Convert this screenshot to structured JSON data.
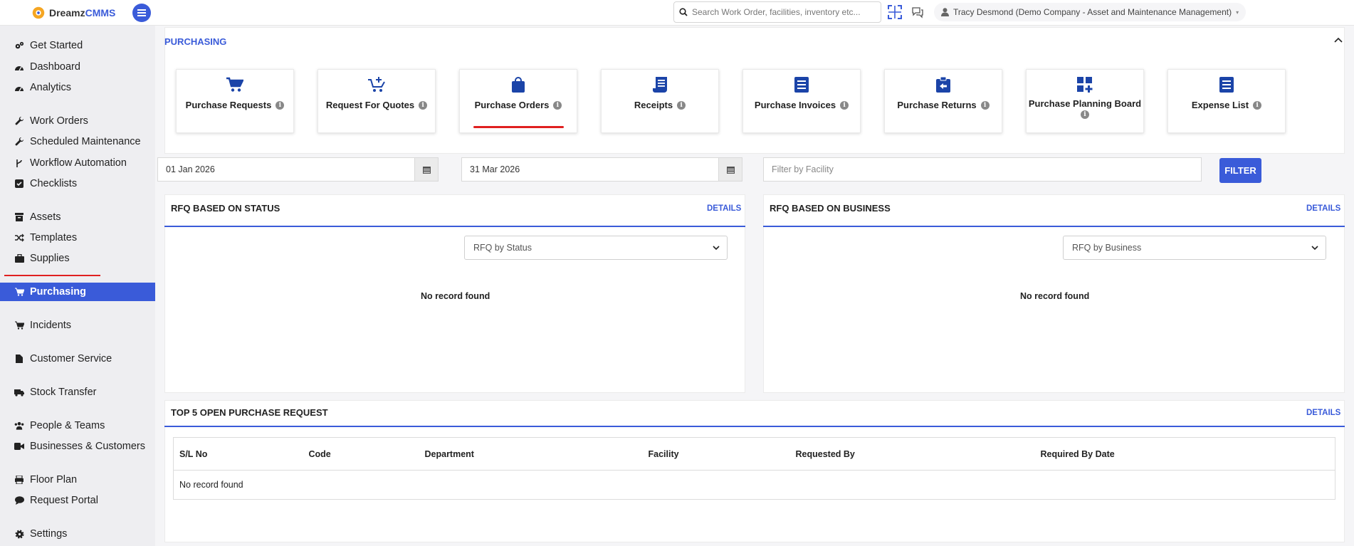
{
  "app": {
    "logo_text_main": "Dreamz",
    "logo_text_accent": "CMMS"
  },
  "topbar": {
    "search_placeholder": "Search Work Order, facilities, inventory etc...",
    "user_label": "Tracy Desmond (Demo Company - Asset and Maintenance Management)"
  },
  "sidebar": {
    "items": [
      {
        "label": "Get Started",
        "icon": "gear-group-icon"
      },
      {
        "label": "Dashboard",
        "icon": "gauge-icon"
      },
      {
        "label": "Analytics",
        "icon": "gauge-icon"
      },
      {
        "label": "Work Orders",
        "icon": "wrench-icon"
      },
      {
        "label": "Scheduled Maintenance",
        "icon": "wrench-icon"
      },
      {
        "label": "Workflow Automation",
        "icon": "branch-icon"
      },
      {
        "label": "Checklists",
        "icon": "checkbox-icon"
      },
      {
        "label": "Assets",
        "icon": "archive-icon"
      },
      {
        "label": "Templates",
        "icon": "shuffle-icon"
      },
      {
        "label": "Supplies",
        "icon": "briefcase-icon"
      },
      {
        "label": "Purchasing",
        "icon": "cart-icon"
      },
      {
        "label": "Incidents",
        "icon": "cart-icon"
      },
      {
        "label": "Customer Service",
        "icon": "file-icon"
      },
      {
        "label": "Stock Transfer",
        "icon": "truck-icon"
      },
      {
        "label": "People & Teams",
        "icon": "users-icon"
      },
      {
        "label": "Businesses & Customers",
        "icon": "video-icon"
      },
      {
        "label": "Floor Plan",
        "icon": "print-icon"
      },
      {
        "label": "Request Portal",
        "icon": "comment-icon"
      },
      {
        "label": "Settings",
        "icon": "gear-icon"
      }
    ],
    "active": "Purchasing"
  },
  "purchasing": {
    "section_title": "PURCHASING",
    "tiles": [
      {
        "label": "Purchase Requests",
        "icon": "cart-icon"
      },
      {
        "label": "Request For Quotes",
        "icon": "cart-plus-icon"
      },
      {
        "label": "Purchase Orders",
        "icon": "shopping-bag-icon"
      },
      {
        "label": "Receipts",
        "icon": "receipt-icon"
      },
      {
        "label": "Purchase Invoices",
        "icon": "invoice-icon"
      },
      {
        "label": "Purchase Returns",
        "icon": "return-icon"
      },
      {
        "label": "Purchase Planning Board",
        "icon": "grid-plus-icon"
      },
      {
        "label": "Expense List",
        "icon": "list-icon"
      }
    ],
    "selected_tile": "Purchase Orders",
    "info_glyph": "i"
  },
  "filters": {
    "start_date": "01 Jan 2026",
    "end_date": "31 Mar 2026",
    "facility_placeholder": "Filter by Facility",
    "filter_button": "FILTER"
  },
  "panels": {
    "status": {
      "title": "RFQ BASED ON STATUS",
      "link": "DETAILS",
      "select_value": "RFQ by Status",
      "empty": "No record found"
    },
    "business": {
      "title": "RFQ BASED ON BUSINESS",
      "link": "DETAILS",
      "select_value": "RFQ by Business",
      "empty": "No record found"
    }
  },
  "top_requests": {
    "title": "TOP 5 OPEN PURCHASE REQUEST",
    "link": "DETAILS",
    "columns": [
      "S/L No",
      "Code",
      "Department",
      "Facility",
      "Requested By",
      "Required By Date"
    ],
    "empty": "No record found"
  },
  "colors": {
    "accent": "#3a5bd9",
    "highlight_underline": "#e02020",
    "sidebar_bg": "#eeeef1",
    "tile_icon": "#1b44a8"
  }
}
